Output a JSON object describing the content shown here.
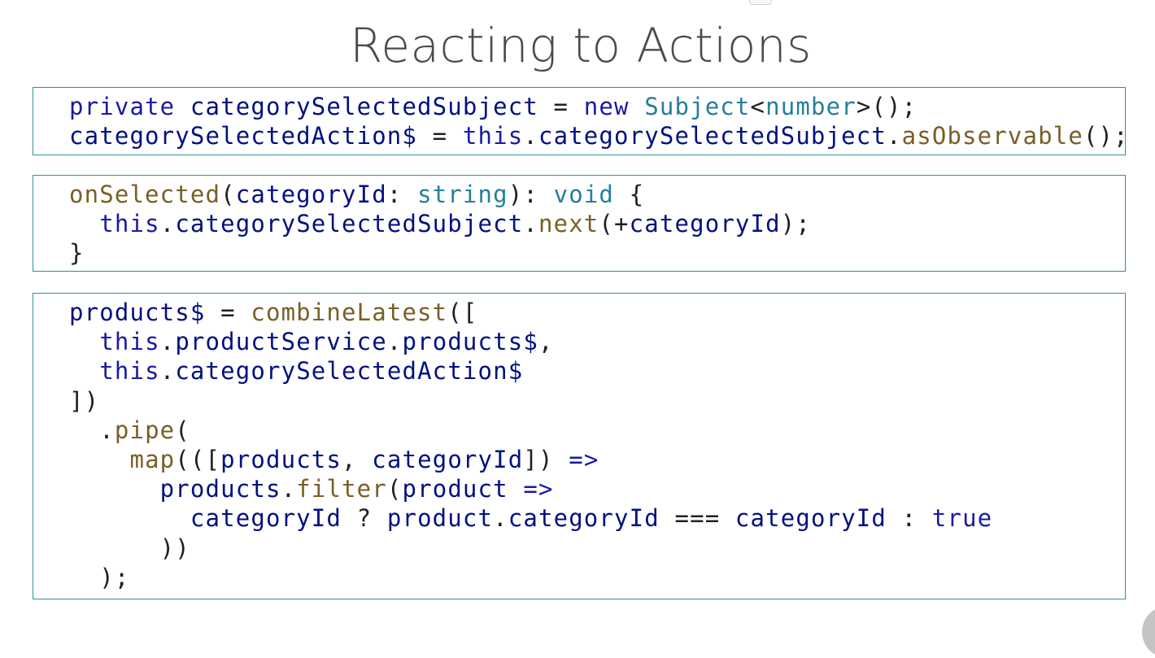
{
  "slide": {
    "title": "Reacting to Actions"
  },
  "code_blocks": [
    {
      "lines": [
        [
          {
            "t": "private",
            "c": "kw"
          },
          {
            "t": " "
          },
          {
            "t": "categorySelectedSubject",
            "c": "id"
          },
          {
            "t": " = "
          },
          {
            "t": "new",
            "c": "kw"
          },
          {
            "t": " "
          },
          {
            "t": "Subject",
            "c": "ty"
          },
          {
            "t": "<"
          },
          {
            "t": "number",
            "c": "ty"
          },
          {
            "t": ">();"
          }
        ],
        [
          {
            "t": "categorySelectedAction$",
            "c": "id"
          },
          {
            "t": " = "
          },
          {
            "t": "this",
            "c": "kw"
          },
          {
            "t": "."
          },
          {
            "t": "categorySelectedSubject",
            "c": "id"
          },
          {
            "t": "."
          },
          {
            "t": "asObservable",
            "c": "fn"
          },
          {
            "t": "();"
          }
        ]
      ]
    },
    {
      "lines": [
        [
          {
            "t": "onSelected",
            "c": "fn"
          },
          {
            "t": "("
          },
          {
            "t": "categoryId",
            "c": "id"
          },
          {
            "t": ": "
          },
          {
            "t": "string",
            "c": "ty"
          },
          {
            "t": "): "
          },
          {
            "t": "void",
            "c": "ty"
          },
          {
            "t": " {"
          }
        ],
        [
          {
            "t": "  "
          },
          {
            "t": "this",
            "c": "kw"
          },
          {
            "t": "."
          },
          {
            "t": "categorySelectedSubject",
            "c": "id"
          },
          {
            "t": "."
          },
          {
            "t": "next",
            "c": "fn"
          },
          {
            "t": "(+"
          },
          {
            "t": "categoryId",
            "c": "id"
          },
          {
            "t": ");"
          }
        ],
        [
          {
            "t": "}"
          }
        ]
      ]
    },
    {
      "lines": [
        [
          {
            "t": "products$",
            "c": "id"
          },
          {
            "t": " = "
          },
          {
            "t": "combineLatest",
            "c": "fn"
          },
          {
            "t": "(["
          }
        ],
        [
          {
            "t": "  "
          },
          {
            "t": "this",
            "c": "kw"
          },
          {
            "t": "."
          },
          {
            "t": "productService",
            "c": "id"
          },
          {
            "t": "."
          },
          {
            "t": "products$",
            "c": "id"
          },
          {
            "t": ","
          }
        ],
        [
          {
            "t": "  "
          },
          {
            "t": "this",
            "c": "kw"
          },
          {
            "t": "."
          },
          {
            "t": "categorySelectedAction$",
            "c": "id"
          }
        ],
        [
          {
            "t": "])"
          }
        ],
        [
          {
            "t": "  ."
          },
          {
            "t": "pipe",
            "c": "fn"
          },
          {
            "t": "("
          }
        ],
        [
          {
            "t": "    "
          },
          {
            "t": "map",
            "c": "fn"
          },
          {
            "t": "(([",
            "c": "pl"
          },
          {
            "t": "products",
            "c": "id"
          },
          {
            "t": ", "
          },
          {
            "t": "categoryId",
            "c": "id"
          },
          {
            "t": "]) "
          },
          {
            "t": "=>",
            "c": "kw"
          }
        ],
        [
          {
            "t": "      "
          },
          {
            "t": "products",
            "c": "id"
          },
          {
            "t": "."
          },
          {
            "t": "filter",
            "c": "fn"
          },
          {
            "t": "("
          },
          {
            "t": "product",
            "c": "id"
          },
          {
            "t": " "
          },
          {
            "t": "=>",
            "c": "kw"
          }
        ],
        [
          {
            "t": "        "
          },
          {
            "t": "categoryId",
            "c": "id"
          },
          {
            "t": " ? "
          },
          {
            "t": "product",
            "c": "id"
          },
          {
            "t": "."
          },
          {
            "t": "categoryId",
            "c": "id"
          },
          {
            "t": " === "
          },
          {
            "t": "categoryId",
            "c": "id"
          },
          {
            "t": " : "
          },
          {
            "t": "true",
            "c": "kw"
          }
        ],
        [
          {
            "t": "      ))"
          }
        ],
        [
          {
            "t": "  );"
          }
        ]
      ]
    }
  ]
}
